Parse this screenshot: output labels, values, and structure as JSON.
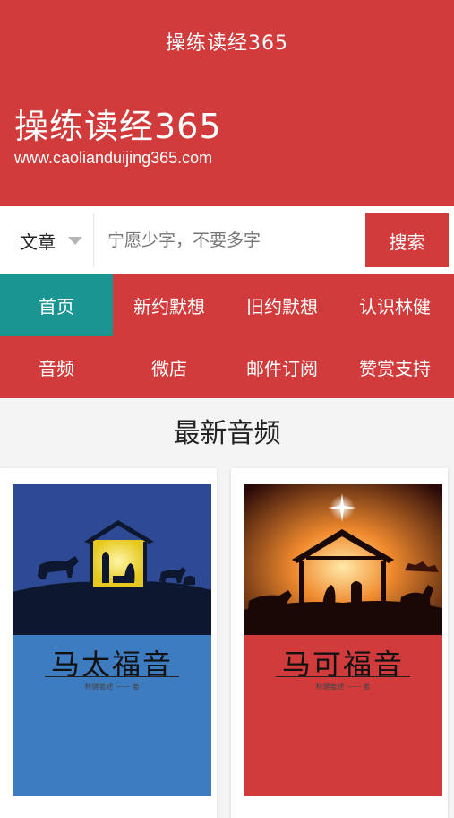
{
  "header": {
    "app_title": "操练读经365",
    "site_name": "操练读经365",
    "site_url": "www.caolianduijing365.com"
  },
  "search": {
    "category_label": "文章",
    "placeholder": "宁愿少字，不要多字",
    "button_label": "搜索"
  },
  "nav": {
    "items": [
      {
        "label": "首页",
        "active": true
      },
      {
        "label": "新约默想"
      },
      {
        "label": "旧约默想"
      },
      {
        "label": "认识林健"
      },
      {
        "label": "音频"
      },
      {
        "label": "微店"
      },
      {
        "label": "邮件订阅"
      },
      {
        "label": "赞赏支持"
      }
    ]
  },
  "section": {
    "title": "最新音频"
  },
  "books": [
    {
      "title": "马太福音",
      "author": "林健著述 —— 著",
      "color": "#3e7cc2"
    },
    {
      "title": "马可福音",
      "author": "林健著述 —— 著",
      "color": "#d13b3b"
    }
  ],
  "colors": {
    "brand_red": "#d13b3b",
    "active_teal": "#1a9591"
  }
}
